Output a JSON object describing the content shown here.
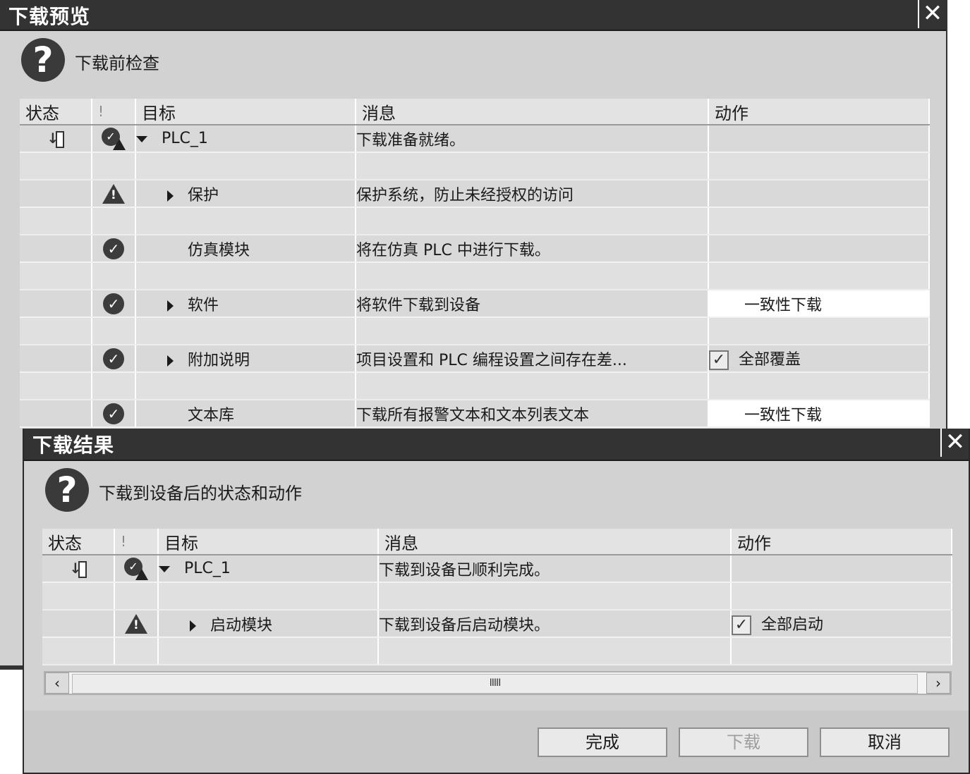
{
  "preview_dialog": {
    "title": "下载预览",
    "close_label": "✕",
    "header_text": "下载前检查",
    "columns": {
      "status": "状态",
      "alert": "!",
      "target": "目标",
      "message": "消息",
      "action": "动作"
    },
    "rows": [
      {
        "target": "PLC_1",
        "message": "下载准备就绪。",
        "action": ""
      },
      {
        "target": "保护",
        "message": "保护系统，防止未经授权的访问",
        "action": ""
      },
      {
        "target": "仿真模块",
        "message": "将在仿真 PLC 中进行下载。",
        "action": ""
      },
      {
        "target": "软件",
        "message": "将软件下载到设备",
        "action": "一致性下载"
      },
      {
        "target": "附加说明",
        "message": "项目设置和 PLC 编程设置之间存在差...",
        "action": "全部覆盖"
      },
      {
        "target": "文本库",
        "message": "下载所有报警文本和文本列表文本",
        "action": "一致性下载"
      }
    ]
  },
  "result_dialog": {
    "title": "下载结果",
    "close_label": "✕",
    "header_text": "下载到设备后的状态和动作",
    "columns": {
      "status": "状态",
      "alert": "!",
      "target": "目标",
      "message": "消息",
      "action": "动作"
    },
    "rows": [
      {
        "target": "PLC_1",
        "message": "下载到设备已顺利完成。",
        "action": ""
      },
      {
        "target": "启动模块",
        "message": "下载到设备后启动模块。",
        "action": "全部启动"
      }
    ],
    "scroll_thumb": "IIIII",
    "buttons": {
      "finish": "完成",
      "download": "下载",
      "cancel": "取消"
    }
  },
  "icons": {
    "question": "question-icon",
    "ok": "check-circle-icon",
    "warning": "warning-icon",
    "download_status": "download-icon"
  }
}
